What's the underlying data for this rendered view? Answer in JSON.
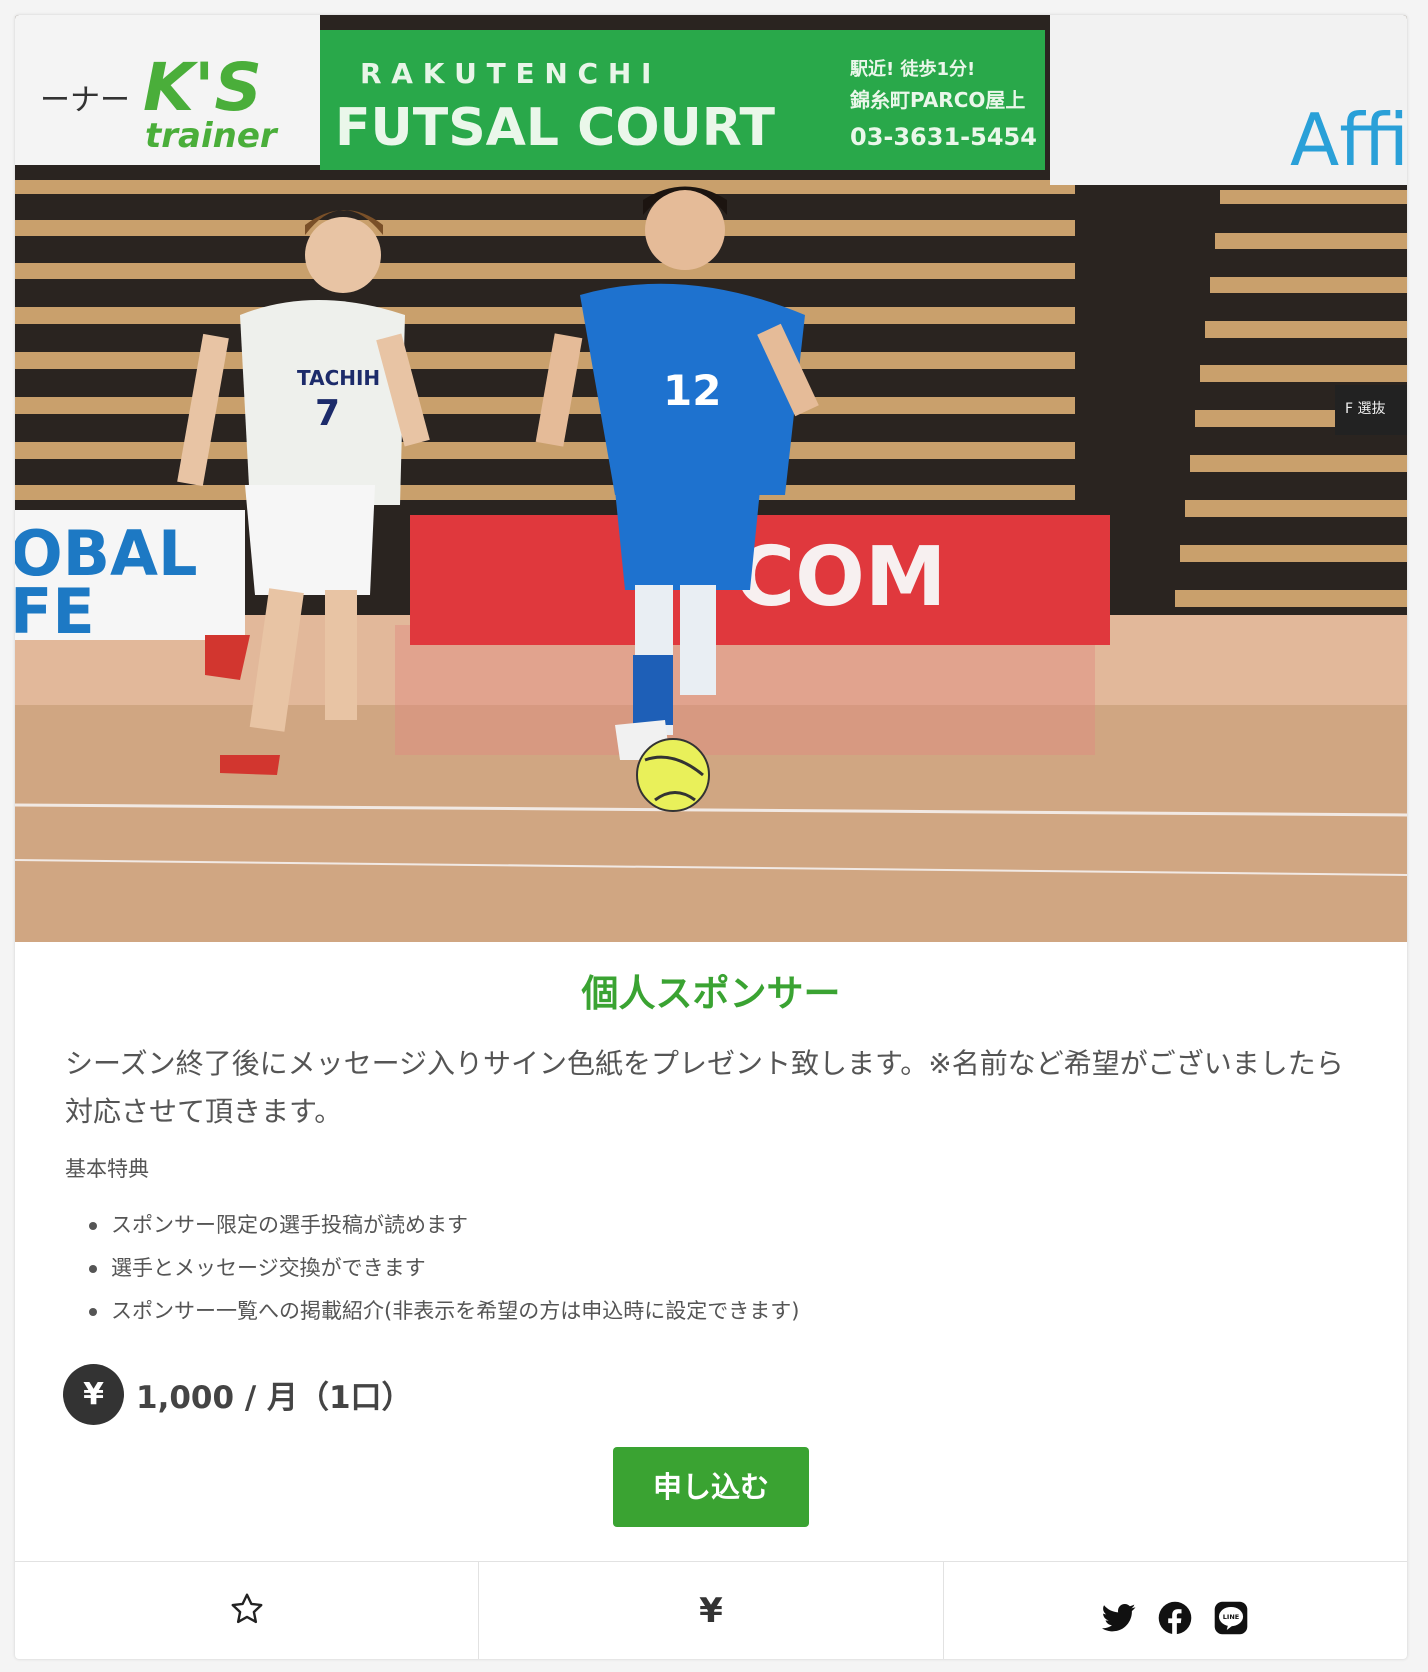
{
  "photo": {
    "alt": "futsal players on court",
    "banner_left_text": "ーナー",
    "banner_brand": "K'S",
    "banner_brand_sub": "trainer",
    "banner_center_top": "R A K U T E N C H I",
    "banner_center_main": "FUTSAL COURT",
    "banner_center_note1": "駅近! 徒歩1分!",
    "banner_center_note2": "錦糸町PARCO屋上",
    "banner_center_phone": "03-3631-5454",
    "banner_right_text": "Affi",
    "board_left_1": "OBAL",
    "board_left_2": "FE",
    "board_red": "COM",
    "player_blue_number": "12",
    "player_white_number": "7",
    "player_white_sponsor": "TACHIH",
    "scoreboard": "F 選抜"
  },
  "plan": {
    "title": "個人スポンサー",
    "description": "シーズン終了後にメッセージ入りサイン色紙をプレゼント致します。※名前など希望がございましたら対応させて頂きます。",
    "benefits_label": "基本特典",
    "benefits": [
      "スポンサー限定の選手投稿が読めます",
      "選手とメッセージ交換ができます",
      "スポンサー一覧への掲載紹介(非表示を希望の方は申込時に設定できます)"
    ],
    "currency_symbol": "¥",
    "price_text": "1,000 / 月（1口）",
    "apply_label": "申し込む"
  },
  "footer": {
    "yen_symbol": "¥",
    "icons": [
      "star-icon",
      "yen-icon",
      "twitter-icon",
      "facebook-icon",
      "line-icon"
    ]
  },
  "colors": {
    "accent": "#3aa332",
    "dark": "#333333"
  }
}
